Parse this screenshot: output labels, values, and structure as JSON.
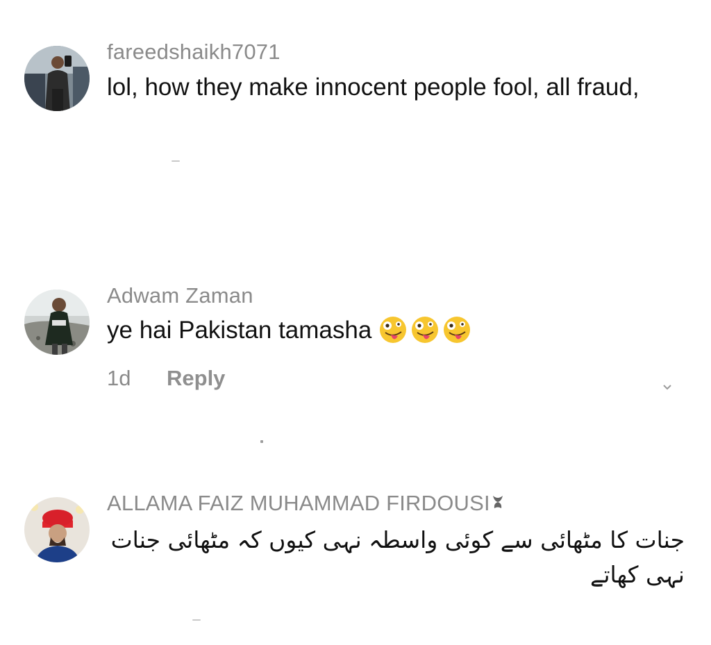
{
  "comments": [
    {
      "username": "fareedshaikh7071",
      "text": "lol, how they make innocent people fool, all fraud,",
      "avatar_icon": "user-avatar-photo"
    },
    {
      "username": "Adwam Zaman",
      "text": "ye hai Pakistan tamasha",
      "emoji_icon": "zany-face-emoji",
      "emoji_count": 3,
      "time": "1d",
      "reply_label": "Reply",
      "avatar_icon": "user-avatar-photo"
    },
    {
      "username": "ALLAMA FAIZ MUHAMMAD FIRDOUSI",
      "badge_icon": "badge-icon",
      "text": "جنات کا مٹھائی سے کوئی واسطہ نہی کیوں کہ مٹھائی جنات نہی کھاتے",
      "avatar_icon": "user-avatar-photo"
    }
  ],
  "colors": {
    "username": "#8a8a8a",
    "text": "#111111",
    "background": "#ffffff"
  }
}
